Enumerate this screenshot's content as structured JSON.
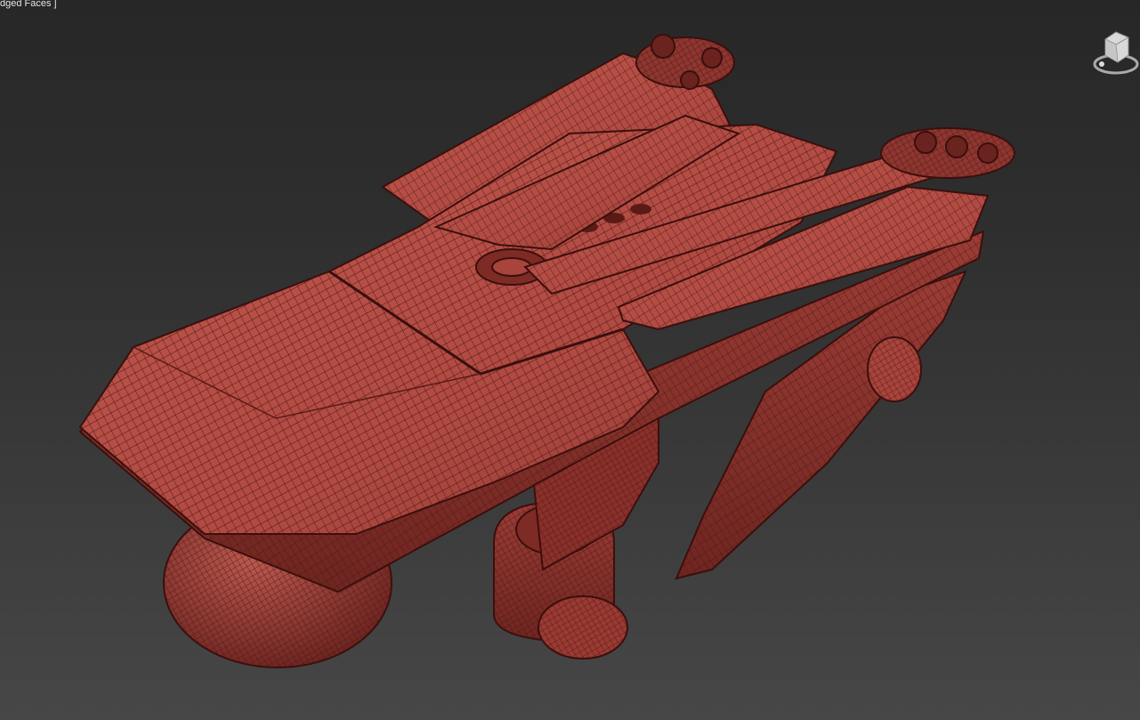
{
  "viewport": {
    "label": "dged Faces ]",
    "background_top": "#272727",
    "background_bottom": "#474747"
  },
  "model": {
    "description_icon": "drone-model",
    "shaded_color": "#b04a42",
    "wire_color": "#4a1512"
  },
  "viewcube": {
    "icon": "viewcube-icon"
  }
}
